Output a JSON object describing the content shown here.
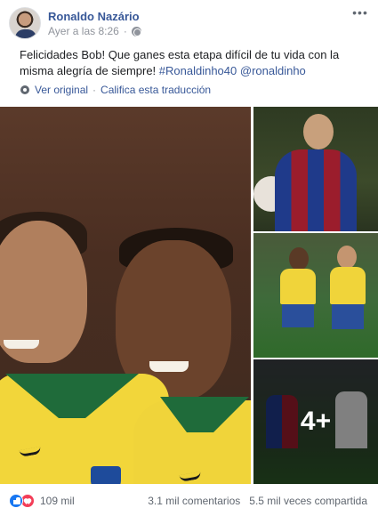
{
  "post": {
    "author": "Ronaldo Nazário",
    "timestamp": "Ayer a las 8:26",
    "separator": "·",
    "audience_icon": "globe-icon",
    "more_label": "•••",
    "message": {
      "text_1": "Felicidades Bob! Que ganes esta etapa difícil de tu vida con la misma alegría de siempre! ",
      "hashtag": "#Ronaldinho40",
      "text_2": " ",
      "mention": "@ronaldinho"
    },
    "translation": {
      "see_original": "Ver original",
      "dot": "·",
      "rate": "Califica esta traducción"
    }
  },
  "photos": {
    "more_overlay": "4+"
  },
  "footer": {
    "reactions_count": "109 mil",
    "comments": "3.1 mil comentarios",
    "shares": "5.5 mil veces compartida"
  },
  "colors": {
    "link": "#385898",
    "like_blue": "#1877f2",
    "love_red": "#f33e58",
    "meta_gray": "#90949c"
  }
}
